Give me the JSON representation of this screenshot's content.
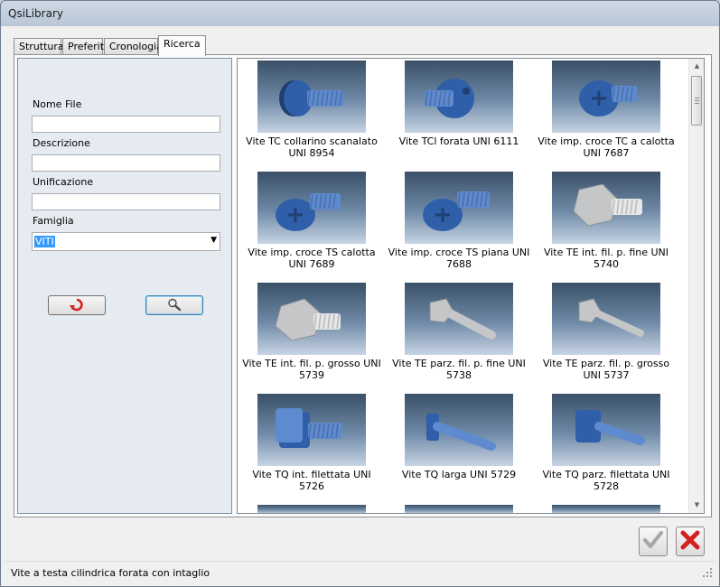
{
  "window": {
    "title": "QsiLibrary"
  },
  "tabs": [
    {
      "label": "Struttura",
      "active": false
    },
    {
      "label": "Preferiti",
      "active": false
    },
    {
      "label": "Cronologia",
      "active": false
    },
    {
      "label": "Ricerca",
      "active": true
    }
  ],
  "search": {
    "filename_label": "Nome File",
    "filename_value": "",
    "description_label": "Descrizione",
    "description_value": "",
    "unification_label": "Unificazione",
    "unification_value": "",
    "family_label": "Famiglia",
    "family_value": "VITI",
    "reset_icon": "undo-arrow-icon",
    "search_icon": "magnifier-icon"
  },
  "results": [
    {
      "label": "Vite TC collarino scanalato UNI 8954",
      "icon": "screw-tc-collar-icon"
    },
    {
      "label": "Vite TCl forata UNI 6111",
      "icon": "screw-tcl-drilled-icon"
    },
    {
      "label": "Vite imp. croce TC a calotta UNI 7687",
      "icon": "screw-cross-dome-icon"
    },
    {
      "label": "Vite imp. croce TS calotta UNI 7689",
      "icon": "screw-cross-countersunk-dome-icon"
    },
    {
      "label": "Vite imp. croce TS piana UNI 7688",
      "icon": "screw-cross-countersunk-flat-icon"
    },
    {
      "label": "Vite TE int. fil. p. fine UNI 5740",
      "icon": "screw-hex-fine-icon"
    },
    {
      "label": "Vite TE int. fil. p. grosso UNI 5739",
      "icon": "screw-hex-coarse-icon"
    },
    {
      "label": "Vite TE parz. fil. p. fine UNI 5738",
      "icon": "screw-hex-partial-fine-icon"
    },
    {
      "label": "Vite TE parz. fil. p. grosso UNI 5737",
      "icon": "screw-hex-partial-coarse-icon"
    },
    {
      "label": "Vite TQ int. filettata UNI 5726",
      "icon": "screw-square-full-icon"
    },
    {
      "label": "Vite TQ larga UNI 5729",
      "icon": "screw-square-wide-icon"
    },
    {
      "label": "Vite TQ parz. filettata UNI 5728",
      "icon": "screw-square-partial-icon"
    }
  ],
  "actions": {
    "confirm_icon": "checkmark-icon",
    "cancel_icon": "red-x-icon"
  },
  "status": {
    "text": "Vite a testa cilindrica forata con intaglio"
  },
  "colors": {
    "accent_blue": "#2f5fa8",
    "steel_gray": "#c4c6c8",
    "selection": "#3399ff",
    "cancel_red": "#d42020"
  }
}
